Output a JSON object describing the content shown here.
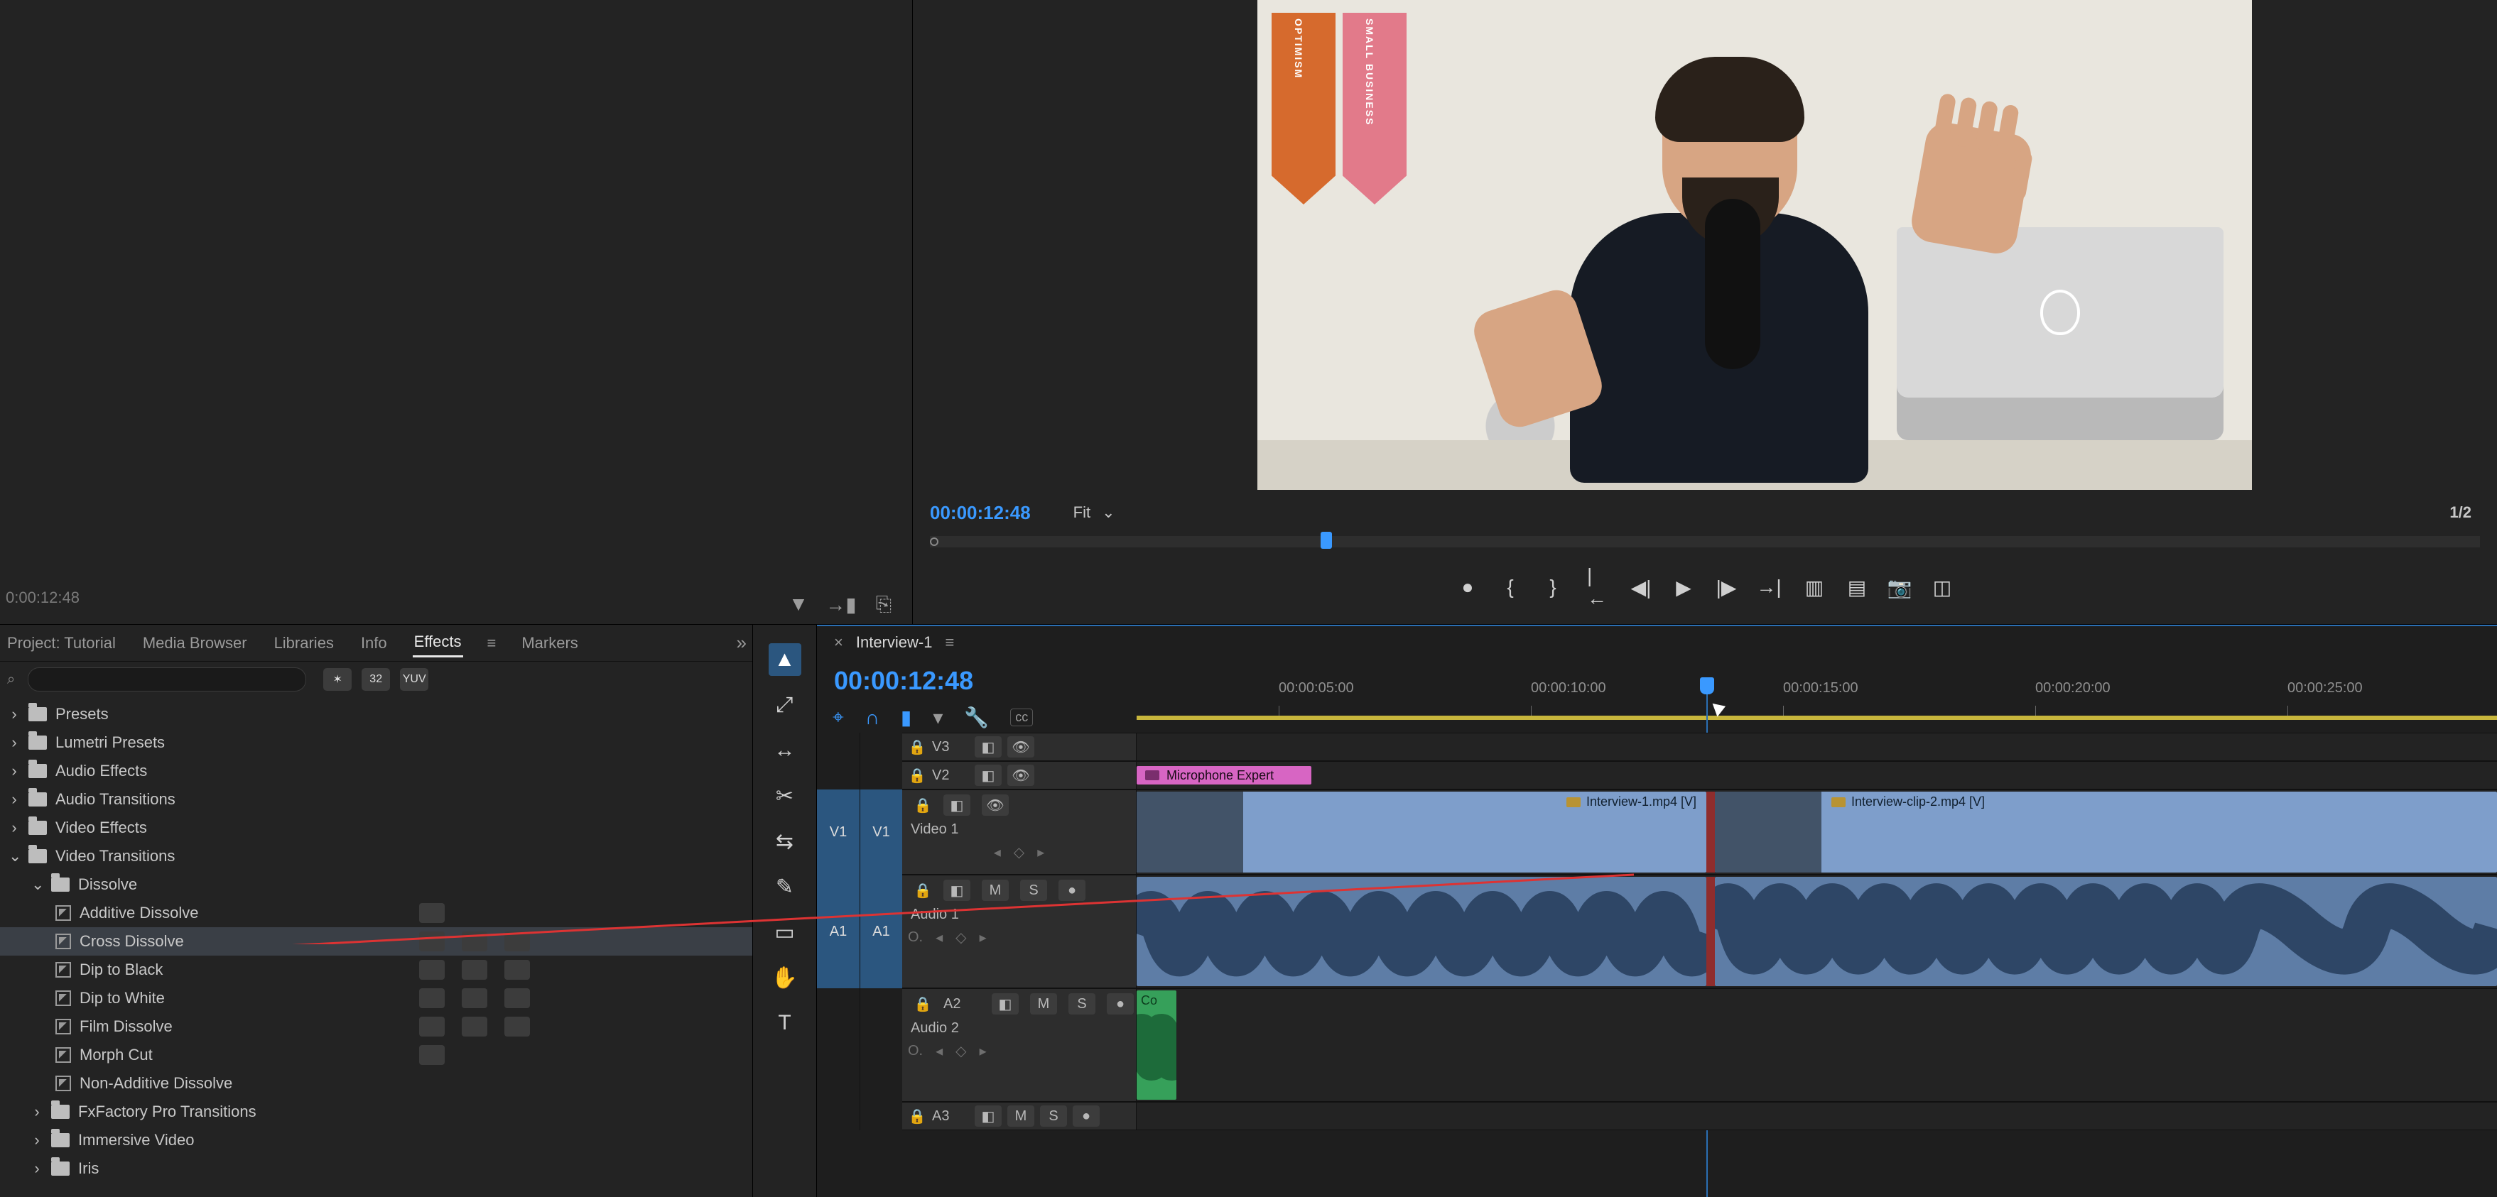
{
  "source": {
    "timecode": "0:00:12:48"
  },
  "program": {
    "timecode": "00:00:12:48",
    "zoom_label": "Fit",
    "resolution": "1/2",
    "pennant1": "OPTIMISM",
    "pennant2": "SMALL BUSINESS"
  },
  "transport": {
    "marker": "●",
    "in": "{",
    "out": "}",
    "goin": "|←",
    "stepb": "◀|",
    "play": "▶",
    "stepf": "|▶",
    "goout": "→|",
    "lift": "▥",
    "extract": "▤",
    "snap": "📷",
    "compare": "◫"
  },
  "panelTabs": {
    "t0": "Project: Tutorial",
    "t1": "Media Browser",
    "t2": "Libraries",
    "t3": "Info",
    "t4": "Effects",
    "t5": "Markers",
    "overflow": "»"
  },
  "search": {
    "placeholder": "",
    "b1": "✶",
    "b2": "32",
    "b3": "YUV"
  },
  "tree": {
    "presets": "Presets",
    "lumetri": "Lumetri Presets",
    "audioFx": "Audio Effects",
    "audioTr": "Audio Transitions",
    "videoFx": "Video Effects",
    "videoTr": "Video Transitions",
    "dissolve": "Dissolve",
    "items": {
      "additive": "Additive Dissolve",
      "cross": "Cross Dissolve",
      "dipBlack": "Dip to Black",
      "dipWhite": "Dip to White",
      "film": "Film Dissolve",
      "morph": "Morph Cut",
      "nonadd": "Non-Additive Dissolve"
    },
    "fxfactory": "FxFactory Pro Transitions",
    "immersive": "Immersive Video",
    "iris": "Iris"
  },
  "tools": {
    "sel": "▲",
    "trackSel": "⤢",
    "ripple": "↔",
    "razor": "✂",
    "slip": "⇆",
    "pen": "✎",
    "rect": "▭",
    "hand": "✋",
    "type": "T"
  },
  "timeline": {
    "close": "×",
    "sequence": "Interview-1",
    "timecode": "00:00:12:48",
    "snap": "⌖",
    "link": "⊘",
    "marker": "▮",
    "insert": "▾",
    "wrench": "🔧",
    "cc": "cc",
    "ruler": [
      "00:00:05:00",
      "00:00:10:00",
      "00:00:15:00",
      "00:00:20:00",
      "00:00:25:00"
    ],
    "tracks": {
      "v3": "V3",
      "v2": "V2",
      "v1src": "V1",
      "v1": "V1",
      "video1": "Video 1",
      "a1src": "A1",
      "a1": "A1",
      "audio1": "Audio 1",
      "a2": "A2",
      "audio2": "Audio 2",
      "a3": "A3",
      "m": "M",
      "s": "S",
      "o": "O.",
      "zero": "0"
    },
    "clips": {
      "title": "Microphone Expert",
      "c1": "Interview-1.mp4 [V]",
      "c2": "Interview-clip-2.mp4 [V]",
      "music": "Co"
    }
  }
}
